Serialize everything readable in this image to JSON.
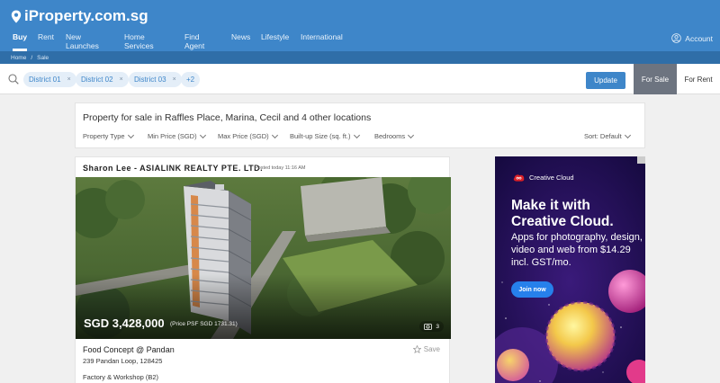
{
  "header": {
    "logo_text": "iProperty.com.sg",
    "nav": [
      "Buy",
      "Rent",
      "New Launches",
      "Home Services",
      "Find Agent",
      "News",
      "Lifestyle",
      "International"
    ],
    "active_nav": "Buy",
    "account_label": "Account"
  },
  "breadcrumb": {
    "home": "Home",
    "sep": "/",
    "current": "Sale"
  },
  "search": {
    "chips": [
      "District 01",
      "District 02",
      "District 03"
    ],
    "more": "+2",
    "chip_remove": "×",
    "update_label": "Update",
    "for_sale_label": "For Sale",
    "for_rent_label": "For Rent"
  },
  "filters": {
    "title": "Property for sale in Raffles Place, Marina, Cecil and 4 other locations",
    "items": [
      "Property Type",
      "Min Price (SGD)",
      "Max Price (SGD)",
      "Built-up Size (sq. ft.)",
      "Bedrooms"
    ],
    "sort": "Sort: Default"
  },
  "listing": {
    "agent": "Sharon Lee - ASIALINK REALTY PTE. LTD.",
    "posted": "Posted today 11:16 AM",
    "price": "SGD 3,428,000",
    "psf": "(Price PSF SGD 1731.31)",
    "photo_count": "3",
    "title": "Food Concept @ Pandan",
    "address": "239 Pandan Loop, 128425",
    "save_label": "Save",
    "property_type": "Factory & Workshop (B2)"
  },
  "ad": {
    "brand": "Creative Cloud",
    "headline_1": "Make it with",
    "headline_2": "Creative Cloud.",
    "body": "Apps for photography, design, video and web from $14.29 incl. GST/mo.",
    "cta": "Join now",
    "colors": {
      "brand_red": "#da1f26",
      "cta_blue": "#2680eb"
    }
  },
  "colors": {
    "header_blue": "#3e86c9",
    "breadcrumb_blue": "#2f6ea8",
    "tab_grey": "#6d7480"
  }
}
